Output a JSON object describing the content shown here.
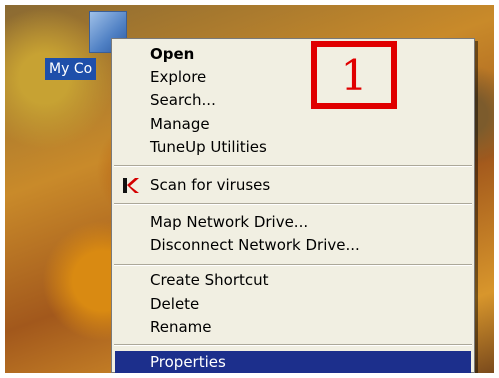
{
  "desktop": {
    "icon_label": "My Co"
  },
  "menu": {
    "items": [
      {
        "label": "Open",
        "bold": true
      },
      {
        "label": "Explore"
      },
      {
        "label": "Search..."
      },
      {
        "label": "Manage"
      },
      {
        "label": "TuneUp Utilities"
      },
      {
        "label": "Scan for viruses",
        "icon": "kaspersky-k-icon"
      },
      {
        "label": "Map Network Drive..."
      },
      {
        "label": "Disconnect Network Drive..."
      },
      {
        "label": "Create Shortcut"
      },
      {
        "label": "Delete"
      },
      {
        "label": "Rename"
      },
      {
        "label": "Properties",
        "selected": true
      }
    ],
    "selection_color": "#1c2f8c",
    "background_color": "#f1efe2"
  },
  "annotation": {
    "marker_text": "1",
    "marker_color": "#e00000"
  }
}
